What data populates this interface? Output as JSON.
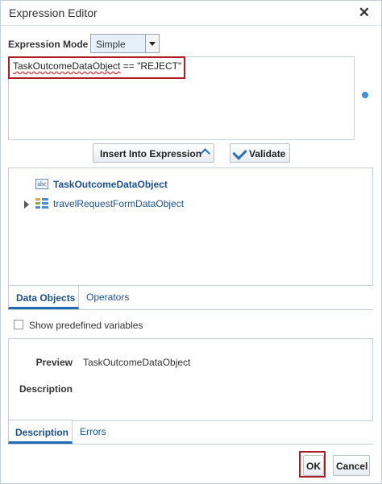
{
  "window": {
    "title": "Expression Editor"
  },
  "mode": {
    "label": "Expression Mode",
    "value": "Simple"
  },
  "expression": {
    "object": "TaskOutcomeDataObject",
    "rest": " == \"REJECT\""
  },
  "buttons": {
    "insert": "Insert Into Expression",
    "validate": "Validate",
    "ok": "OK",
    "cancel": "Cancel"
  },
  "tree": {
    "items": [
      {
        "label": "TaskOutcomeDataObject"
      },
      {
        "label": "travelRequestFormDataObject"
      }
    ]
  },
  "tabs1": [
    {
      "label": "Data Objects"
    },
    {
      "label": "Operators"
    }
  ],
  "predefined": {
    "label": "Show predefined variables"
  },
  "preview": {
    "label": "Preview",
    "value": "TaskOutcomeDataObject",
    "description_label": "Description"
  },
  "tabs2": [
    {
      "label": "Description"
    },
    {
      "label": "Errors"
    }
  ]
}
